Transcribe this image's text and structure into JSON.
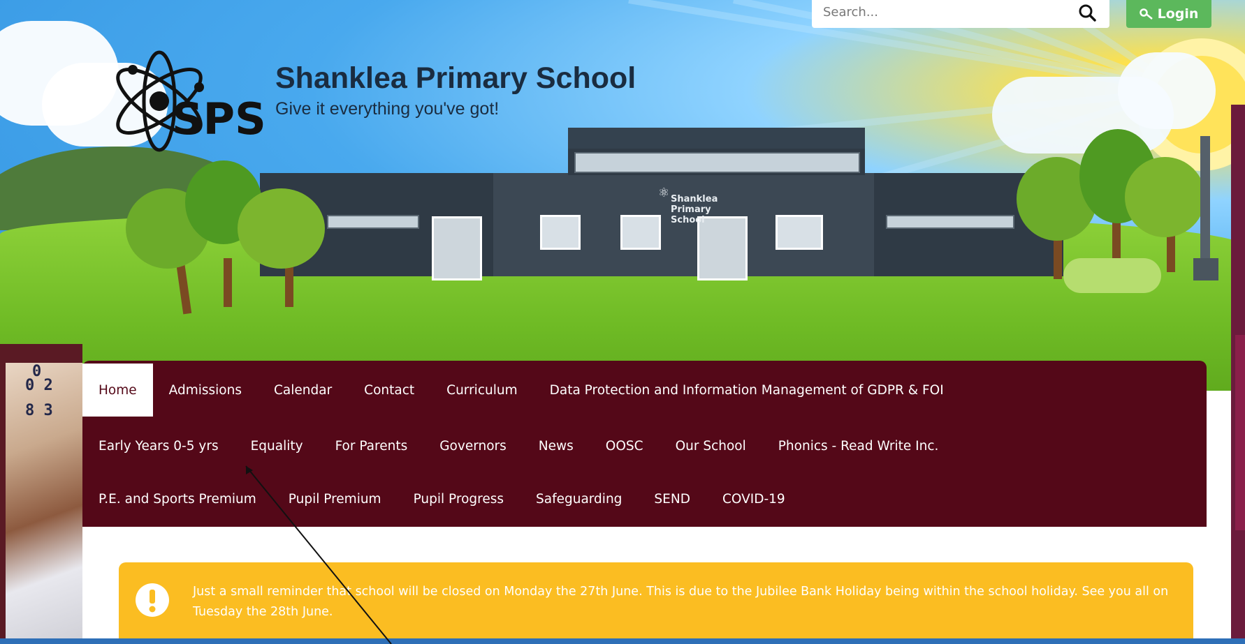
{
  "header": {
    "title": "Shanklea Primary School",
    "tagline": "Give it everything you've got!",
    "logo_text": "SPS",
    "building_sign": "Shanklea Primary School"
  },
  "search": {
    "placeholder": "Search...",
    "icon": "search-icon"
  },
  "login": {
    "label": "Login",
    "icon": "key-icon",
    "color": "#5cb85c"
  },
  "nav": {
    "color": "#540818",
    "rows": [
      [
        "Home",
        "Admissions",
        "Calendar",
        "Contact",
        "Curriculum",
        "Data Protection and Information Management of GDPR & FOI"
      ],
      [
        "Early Years 0-5 yrs",
        "Equality",
        "For Parents",
        "Governors",
        "News",
        "OOSC",
        "Our School",
        "Phonics - Read Write Inc."
      ],
      [
        "P.E. and Sports Premium",
        "Pupil Premium",
        "Pupil Progress",
        "Safeguarding",
        "SEND",
        "COVID-19"
      ]
    ],
    "active": "Home"
  },
  "alert": {
    "icon": "exclamation-icon",
    "color": "#fbbd22",
    "text": "Just a small reminder that school will be closed on Monday the 27th June. This is due to the Jubilee Bank Holiday being within the school holiday. See you all on Tuesday the 28th June."
  },
  "photo": {
    "digits": [
      "0",
      "0 2",
      "8 3"
    ]
  }
}
